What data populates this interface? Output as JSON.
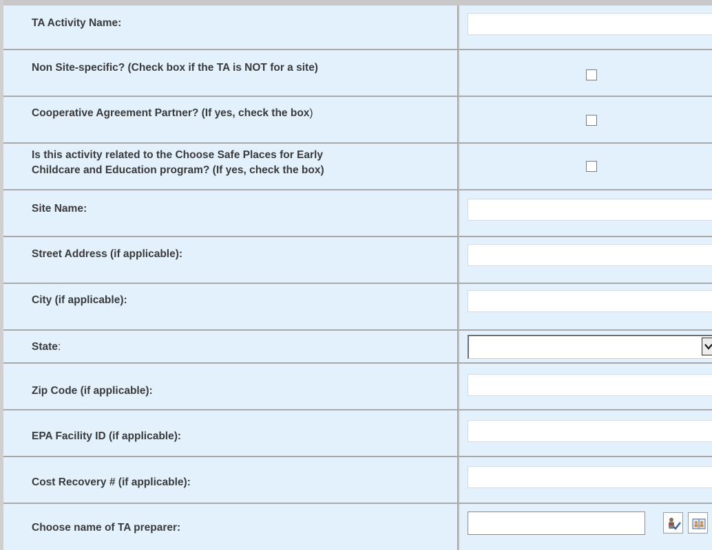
{
  "form": {
    "ta_activity_name": {
      "label": "TA Activity Name:",
      "value": ""
    },
    "non_site_specific": {
      "label": "Non Site-specific? (Check box if the TA is NOT for a site)",
      "checked": false
    },
    "cooperative_partner": {
      "label_bold": "Cooperative Agreement Partner? (If yes, check the box",
      "label_tail": ")",
      "checked": false
    },
    "choose_safe_places": {
      "label_line1": "Is this activity related to the Choose Safe Places for Early",
      "label_line2": "Childcare and Education program? (If yes, check the box)",
      "checked": false
    },
    "site_name": {
      "label": "Site Name:",
      "value": ""
    },
    "street_address": {
      "label": "Street Address (if applicable):",
      "value": ""
    },
    "city": {
      "label": "City (if applicable):",
      "value": ""
    },
    "state": {
      "label_bold": "State",
      "label_tail": ":",
      "selected": ""
    },
    "zip_code": {
      "label": "Zip Code (if applicable):",
      "value": ""
    },
    "epa_facility_id": {
      "label": "EPA Facility ID (if applicable):",
      "value": ""
    },
    "cost_recovery": {
      "label": "Cost Recovery # (if applicable):",
      "value": ""
    },
    "ta_preparer": {
      "label": "Choose name of TA preparer:",
      "value": "",
      "check_names_icon": "check-names-icon",
      "browse_icon": "address-book-icon"
    }
  },
  "colors": {
    "row_background": "#e3f1fc",
    "row_separator": "#a9a9a9",
    "label_text": "#3a3a3a"
  }
}
